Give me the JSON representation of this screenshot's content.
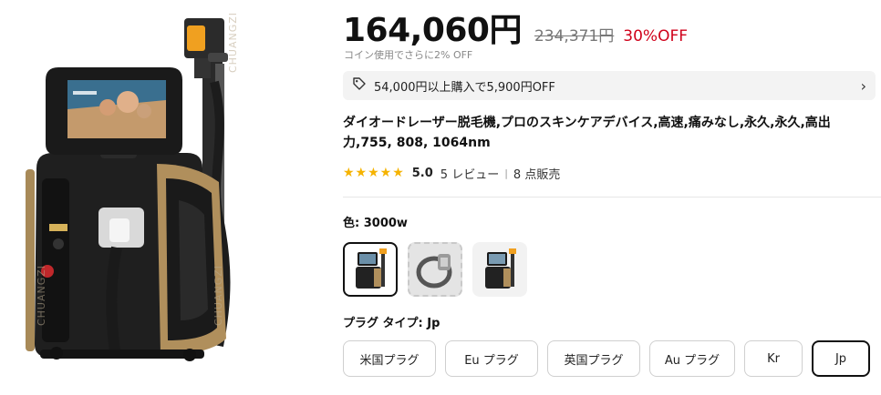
{
  "price": {
    "current": "164,060円",
    "original": "234,371円",
    "discount": "30%OFF",
    "coin_note": "コイン使用でさらに2% OFF"
  },
  "promo": {
    "text": "54,000円以上購入で5,900円OFF",
    "icon": "tag-icon"
  },
  "product": {
    "title": "ダイオードレーザー脱毛機,プロのスキンケアデバイス,高速,痛みなし,永久,永久,高出力,755, 808, 1064nm",
    "image_watermark": "CHUANGZI"
  },
  "rating": {
    "stars": "★★★★★",
    "score": "5.0",
    "reviews": "5 レビュー",
    "separator": "|",
    "sold": "8 点販売"
  },
  "color_option": {
    "label": "色: 3000w",
    "swatches": [
      {
        "name": "machine-front",
        "state": "selected"
      },
      {
        "name": "handpiece",
        "state": "disabled"
      },
      {
        "name": "machine-angle",
        "state": "normal"
      }
    ]
  },
  "plug_option": {
    "label": "プラグ タイプ: Jp",
    "options": [
      "米国プラグ",
      "Eu プラグ",
      "英国プラグ",
      "Au プラグ",
      "Kr",
      "Jp"
    ],
    "selected": "Jp"
  },
  "colors": {
    "discount": "#d0021b",
    "stars": "#f5b301",
    "selected_border": "#111111"
  }
}
